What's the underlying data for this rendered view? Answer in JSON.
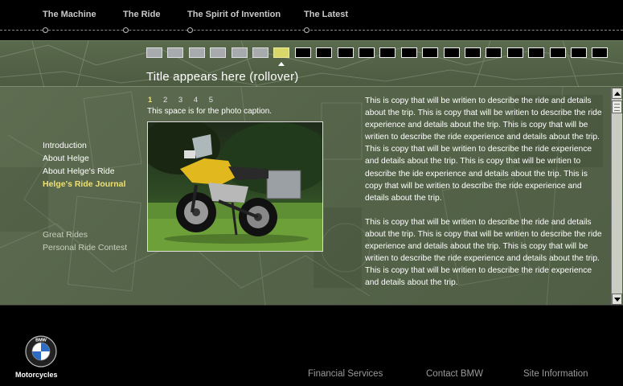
{
  "nav": {
    "items": [
      "The Machine",
      "The Ride",
      "The Spirit of Invention",
      "The Latest"
    ]
  },
  "header": {
    "title": "Title appears here (rollover)",
    "thumbnails": {
      "total": 22,
      "viewed": 6,
      "current_index": 7
    }
  },
  "sidebar": {
    "primary": [
      {
        "label": "Introduction"
      },
      {
        "label": "About Helge"
      },
      {
        "label": "About Helge's Ride"
      },
      {
        "label": "Helge's Ride Journal"
      }
    ],
    "secondary": [
      {
        "label": "Great Rides"
      },
      {
        "label": "Personal Ride Contest"
      }
    ]
  },
  "pager": {
    "pages": [
      "1",
      "2",
      "3",
      "4",
      "5"
    ],
    "current": "1"
  },
  "photo": {
    "caption": "This space is for the photo caption."
  },
  "content": {
    "paragraph1": "This is copy that will be writien to describe the ride and details about the trip. This is copy that will be writien to describe the ride experience and details about the trip. This is copy that will be writien to describe the ride experience and details about the trip. This is copy that will be writien to describe the ride experience and details about the trip. This is copy that will be writien to describe the ide experience and details about the trip. This is copy that will be writien to describe the ride experience and details about the trip.",
    "paragraph2": "This is copy that will be writien to describe the ride and details about the trip. This is copy that will be writien to describe the ride experience and details about the trip. This is copy that will be writien to describe the ride experience and details about the trip. This is copy that will be writien to describe the ride experience and details about the trip."
  },
  "footer": {
    "brand": "Motorcycles",
    "logo_letters": "BMW",
    "links": [
      "Financial Services",
      "Contact BMW",
      "Site Information"
    ]
  },
  "colors": {
    "accent": "#ece074",
    "panel": "#56654a",
    "thumb_viewed": "#a7abae"
  }
}
